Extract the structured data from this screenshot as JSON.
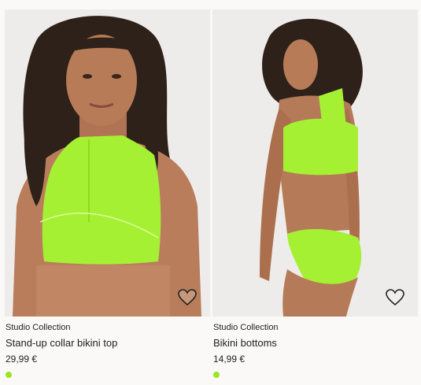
{
  "products": [
    {
      "brand": "Studio Collection",
      "title": "Stand-up collar bikini top",
      "price": "29,99 €",
      "swatch_color": "#9be61e",
      "favorite_icon": "heart-outline-icon"
    },
    {
      "brand": "Studio Collection",
      "title": "Bikini bottoms",
      "price": "14,99 €",
      "swatch_color": "#9be61e",
      "favorite_icon": "heart-outline-icon"
    }
  ],
  "colors": {
    "garment": "#a6f034",
    "background": "#faf9f8",
    "photo_bg": "#eeecea"
  }
}
